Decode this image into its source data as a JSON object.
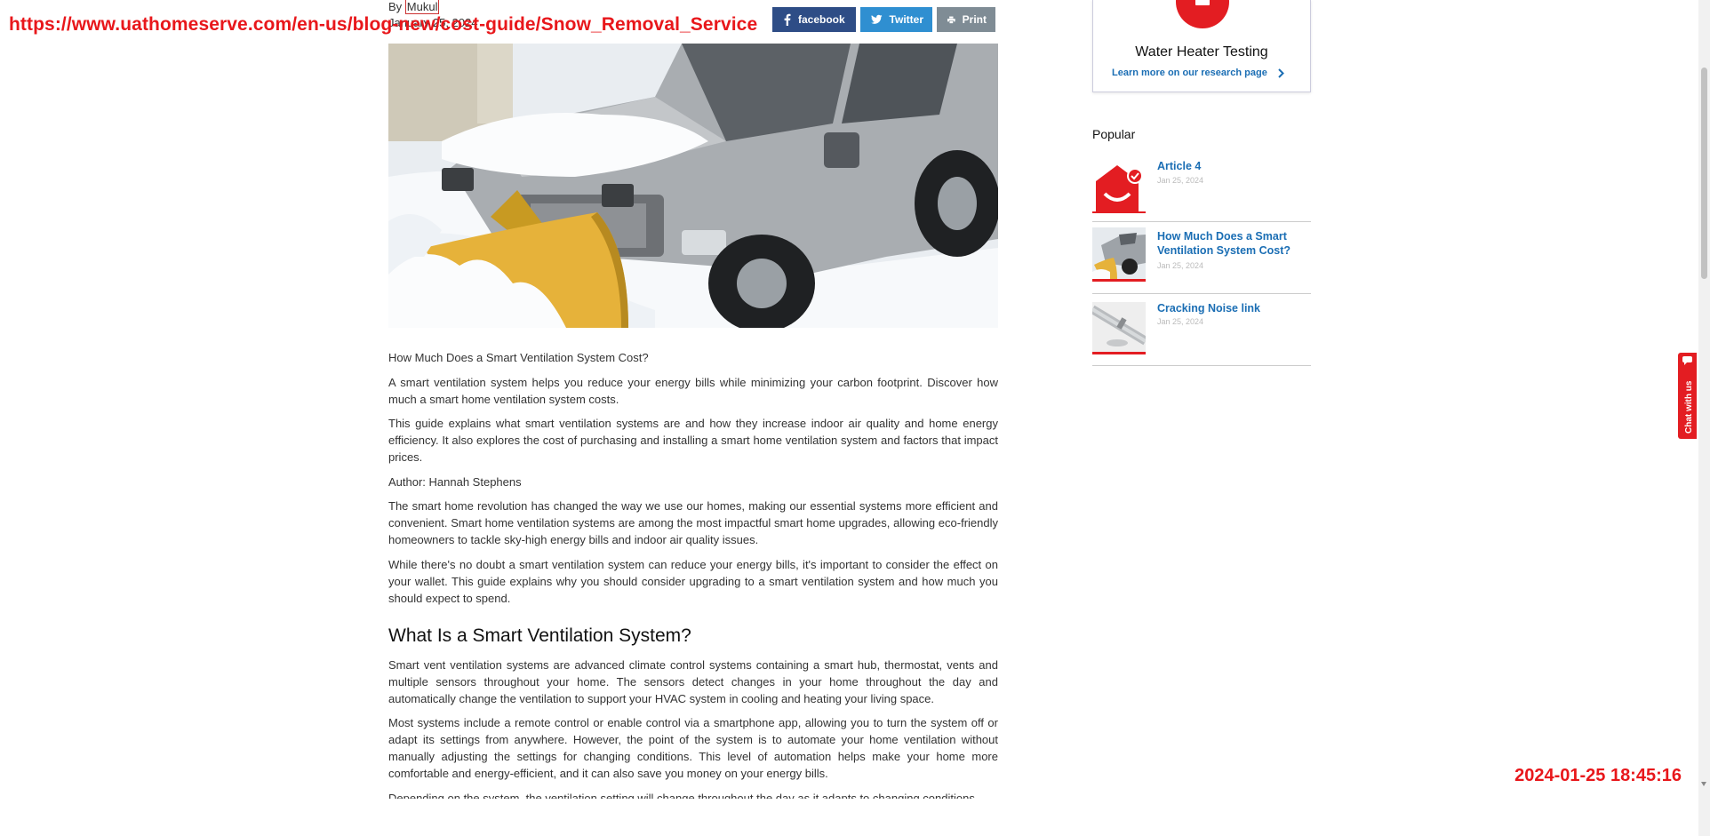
{
  "overlay": {
    "url": "https://www.uathomeserve.com/en-us/blog-new/cost-guide/Snow_Removal_Service",
    "timestamp": "2024-01-25 18:45:16"
  },
  "article": {
    "by_prefix": "By",
    "author": "Mukul",
    "date": "January 25, 2024",
    "share": {
      "facebook": "facebook",
      "twitter": "Twitter",
      "print": "Print"
    },
    "paragraphs_intro": [
      "How Much Does a Smart Ventilation System Cost?",
      "A smart ventilation system helps you reduce your energy bills while minimizing your carbon footprint. Discover how much a smart home ventilation system costs.",
      "This guide explains what smart ventilation systems are and how they increase indoor air quality and home energy efficiency. It also explores the cost of purchasing and installing a smart home ventilation system and factors that impact prices.",
      "Author: Hannah Stephens",
      "The smart home revolution has changed the way we use our homes, making our essential systems more efficient and convenient. Smart home ventilation systems are among the most impactful smart home upgrades, allowing eco-friendly homeowners to tackle sky-high energy bills and indoor air quality issues.",
      "While there's no doubt a smart ventilation system can reduce your energy bills, it's important to consider the effect on your wallet. This guide explains why you should consider upgrading to a smart ventilation system and how much you should expect to spend."
    ],
    "heading": "What Is a Smart Ventilation System?",
    "paragraphs_section": [
      "Smart vent ventilation systems are advanced climate control systems containing a smart hub, thermostat, vents and multiple sensors throughout your home. The sensors detect changes in your home throughout the day and automatically change the ventilation to support your HVAC system in cooling and heating your living space.",
      "Most systems include a remote control or enable control via a smartphone app, allowing you to turn the system off or adapt its settings from anywhere. However, the point of the system is to automate your home ventilation without manually adjusting the settings for changing conditions. This level of automation helps make your home more comfortable and energy-efficient, and it can also save you money on your energy bills.",
      "Depending on the system, the ventilation setting will change throughout the day as it adapts to changing conditions."
    ]
  },
  "sidebar": {
    "card": {
      "title": "Water Heater Testing",
      "link": "Learn more on our research page"
    },
    "popular_title": "Popular",
    "popular": [
      {
        "title": "Article 4",
        "date": "Jan 25, 2024"
      },
      {
        "title": "How Much Does a Smart Ventilation System Cost?",
        "date": "Jan 25, 2024"
      },
      {
        "title": "Cracking Noise link",
        "date": "Jan 25, 2024"
      }
    ]
  },
  "chat": {
    "label": "Chat with us"
  },
  "colors": {
    "accent_red": "#e31d22",
    "link_blue": "#1b6eb4",
    "facebook": "#2e4d86",
    "twitter": "#2f8fd1"
  }
}
